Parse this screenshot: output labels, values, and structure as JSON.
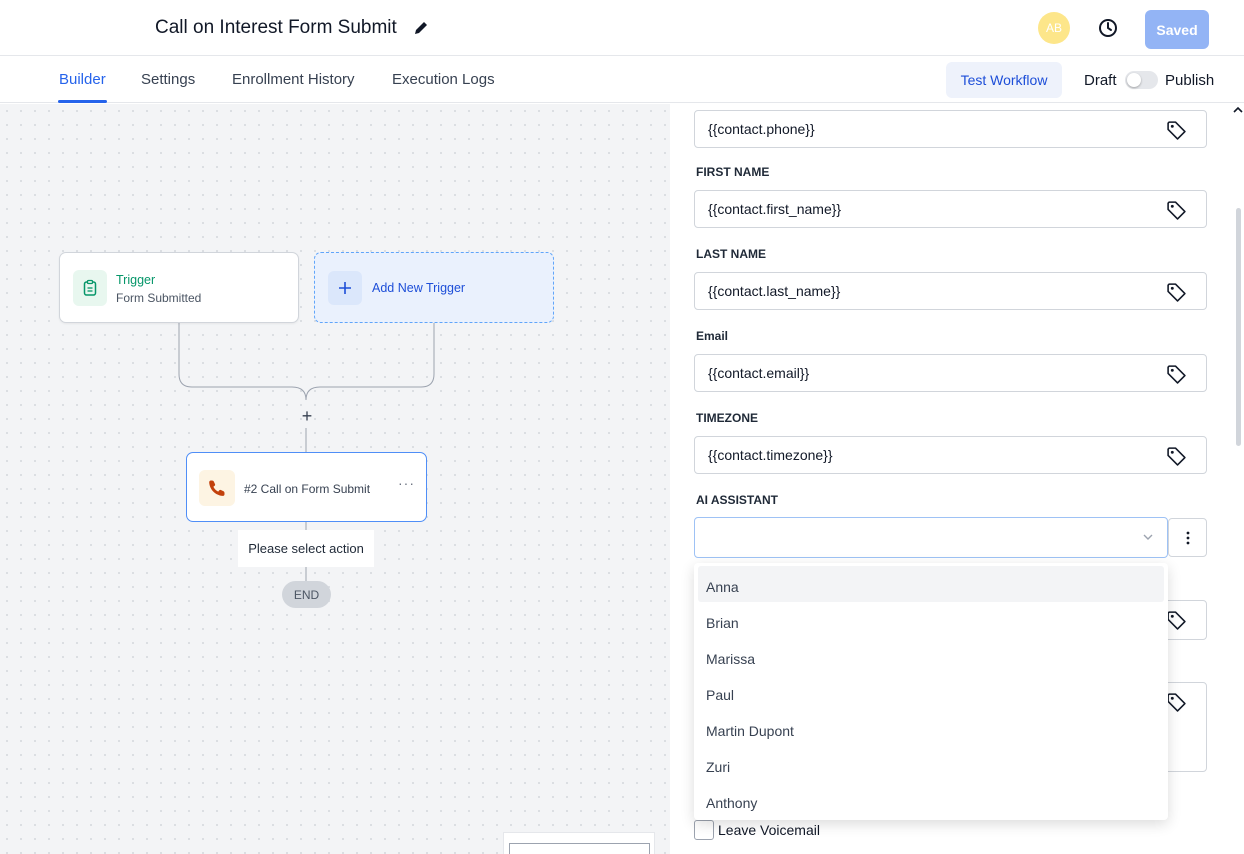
{
  "header": {
    "title": "Call on Interest Form Submit",
    "avatar_initials": "AB",
    "saved_label": "Saved"
  },
  "tabs": [
    {
      "label": "Builder",
      "active": true
    },
    {
      "label": "Settings"
    },
    {
      "label": "Enrollment History"
    },
    {
      "label": "Execution Logs"
    }
  ],
  "toolbar": {
    "test_workflow": "Test Workflow",
    "draft": "Draft",
    "publish": "Publish",
    "publish_toggle_on": false
  },
  "canvas": {
    "trigger": {
      "title": "Trigger",
      "subtitle": "Form Submitted"
    },
    "add_trigger": "Add New Trigger",
    "action": {
      "label": "#2 Call on Form Submit",
      "menu": "···"
    },
    "select_action": "Please select action",
    "end": "END",
    "plus": "+"
  },
  "panel": {
    "fields": [
      {
        "label": "",
        "value": "{{contact.phone}}"
      },
      {
        "label": "FIRST NAME",
        "value": "{{contact.first_name}}"
      },
      {
        "label": "LAST NAME",
        "value": "{{contact.last_name}}"
      },
      {
        "label": "Email",
        "value": "{{contact.email}}"
      },
      {
        "label": "TIMEZONE",
        "value": "{{contact.timezone}}"
      }
    ],
    "ai_assistant": {
      "label": "AI ASSISTANT",
      "value": "",
      "options": [
        "Anna",
        "Brian",
        "Marissa",
        "Paul",
        "Martin Dupont",
        "Zuri",
        "Anthony"
      ],
      "highlighted": "Anna"
    },
    "leave_voicemail": {
      "label": "Leave Voicemail",
      "checked": false
    }
  },
  "colors": {
    "accent": "#2563eb",
    "saved_button": "#93b4f5",
    "trigger_green": "#059669",
    "avatar": "#fde68a"
  }
}
